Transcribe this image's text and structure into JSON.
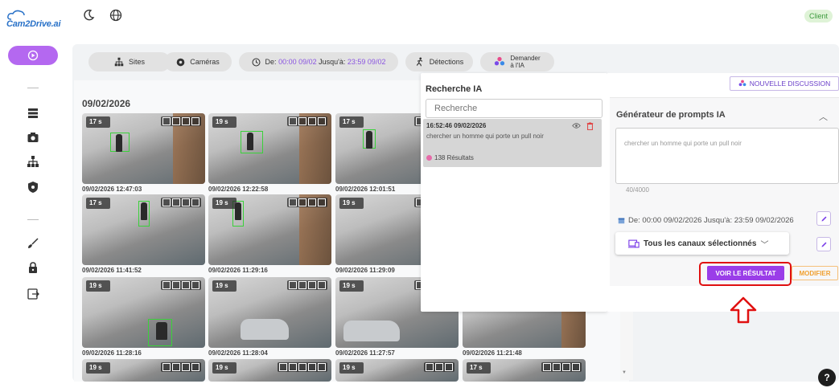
{
  "brand": {
    "logo_text": "Cam2Drive.ai"
  },
  "topbar": {
    "client_badge": "Client"
  },
  "filters": {
    "sites": "Sites",
    "cameras": "Caméras",
    "date_prefix": "De:",
    "date_from": "00:00 09/02",
    "date_mid": "Jusqu'à:",
    "date_to": "23:59 09/02",
    "detections": "Détections",
    "ask_ai_line1": "Demander",
    "ask_ai_line2": "à l'IA"
  },
  "grid": {
    "date_heading": "09/02/2026",
    "rows": [
      [
        {
          "duration": "17 s",
          "caption": "09/02/2026 12:47:03"
        },
        {
          "duration": "19 s",
          "caption": "09/02/2026 12:22:58"
        },
        {
          "duration": "17 s",
          "caption": "09/02/2026 12:01:51"
        }
      ],
      [
        {
          "duration": "17 s",
          "caption": "09/02/2026 11:41:52"
        },
        {
          "duration": "19 s",
          "caption": "09/02/2026 11:29:16"
        },
        {
          "duration": "19 s",
          "caption": "09/02/2026 11:29:09"
        }
      ],
      [
        {
          "duration": "19 s",
          "caption": "09/02/2026 11:28:16"
        },
        {
          "duration": "19 s",
          "caption": "09/02/2026 11:28:04"
        },
        {
          "duration": "19 s",
          "caption": "09/02/2026 11:27:57"
        },
        {
          "duration": "",
          "caption": "09/02/2026 11:21:48"
        }
      ],
      [
        {
          "duration": "19 s"
        },
        {
          "duration": "19 s"
        },
        {
          "duration": "19 s"
        },
        {
          "duration": "17 s"
        }
      ]
    ]
  },
  "search_panel": {
    "title": "Recherche IA",
    "search_placeholder": "Recherche",
    "result": {
      "timestamp": "16:52:46 09/02/2026",
      "query": "chercher un homme qui porte un pull noir",
      "count": "138 Résultats"
    }
  },
  "prompt_panel": {
    "new_discussion": "NOUVELLE DISCUSSION",
    "title": "Générateur de prompts IA",
    "prompt_text": "chercher un homme qui porte un pull noir",
    "char_count": "40/4000",
    "date_range": "De: 00:00 09/02/2026 Jusqu'à: 23:59 09/02/2026",
    "channels": "Tous les canaux sélectionnés",
    "view_result": "VOIR LE RÉSULTAT",
    "modify": "MODIFIER"
  },
  "help": {
    "label": "?"
  },
  "colors": {
    "accent": "#9a3de8",
    "sidebar_active": "#b468f0",
    "highlight_ring": "#e01010",
    "date_text": "#8a55e0",
    "badge_green": "#3d9a3d"
  },
  "icons": [
    "moon-icon",
    "globe-icon",
    "play-icon",
    "server-icon",
    "camera-icon",
    "sitemap-icon",
    "shield-icon",
    "brush-icon",
    "lock-icon",
    "logout-icon",
    "sparkle-icon",
    "eye-icon",
    "trash-icon",
    "calendar-icon",
    "pencil-icon",
    "devices-icon",
    "chevron-down-icon",
    "chevron-up-icon",
    "help-icon",
    "arrow-up-icon"
  ]
}
